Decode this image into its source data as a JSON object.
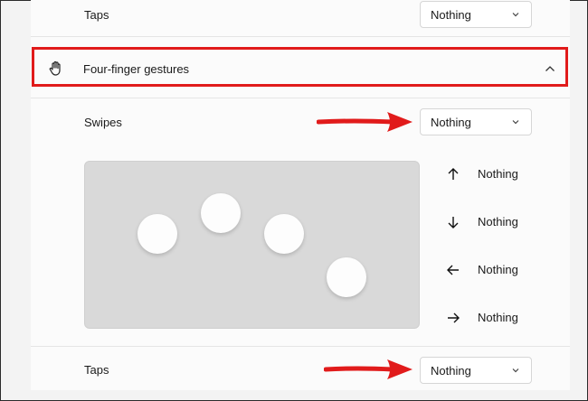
{
  "top_row": {
    "label": "Taps",
    "value": "Nothing"
  },
  "section": {
    "title": "Four-finger gestures"
  },
  "swipes": {
    "label": "Swipes",
    "value": "Nothing"
  },
  "directions": [
    {
      "icon": "arrow-up-icon",
      "label": "Nothing"
    },
    {
      "icon": "arrow-down-icon",
      "label": "Nothing"
    },
    {
      "icon": "arrow-left-icon",
      "label": "Nothing"
    },
    {
      "icon": "arrow-right-icon",
      "label": "Nothing"
    }
  ],
  "bottom_row": {
    "label": "Taps",
    "value": "Nothing"
  },
  "colors": {
    "highlight": "#e11b1b",
    "touchpad": "#d9d9d9"
  }
}
